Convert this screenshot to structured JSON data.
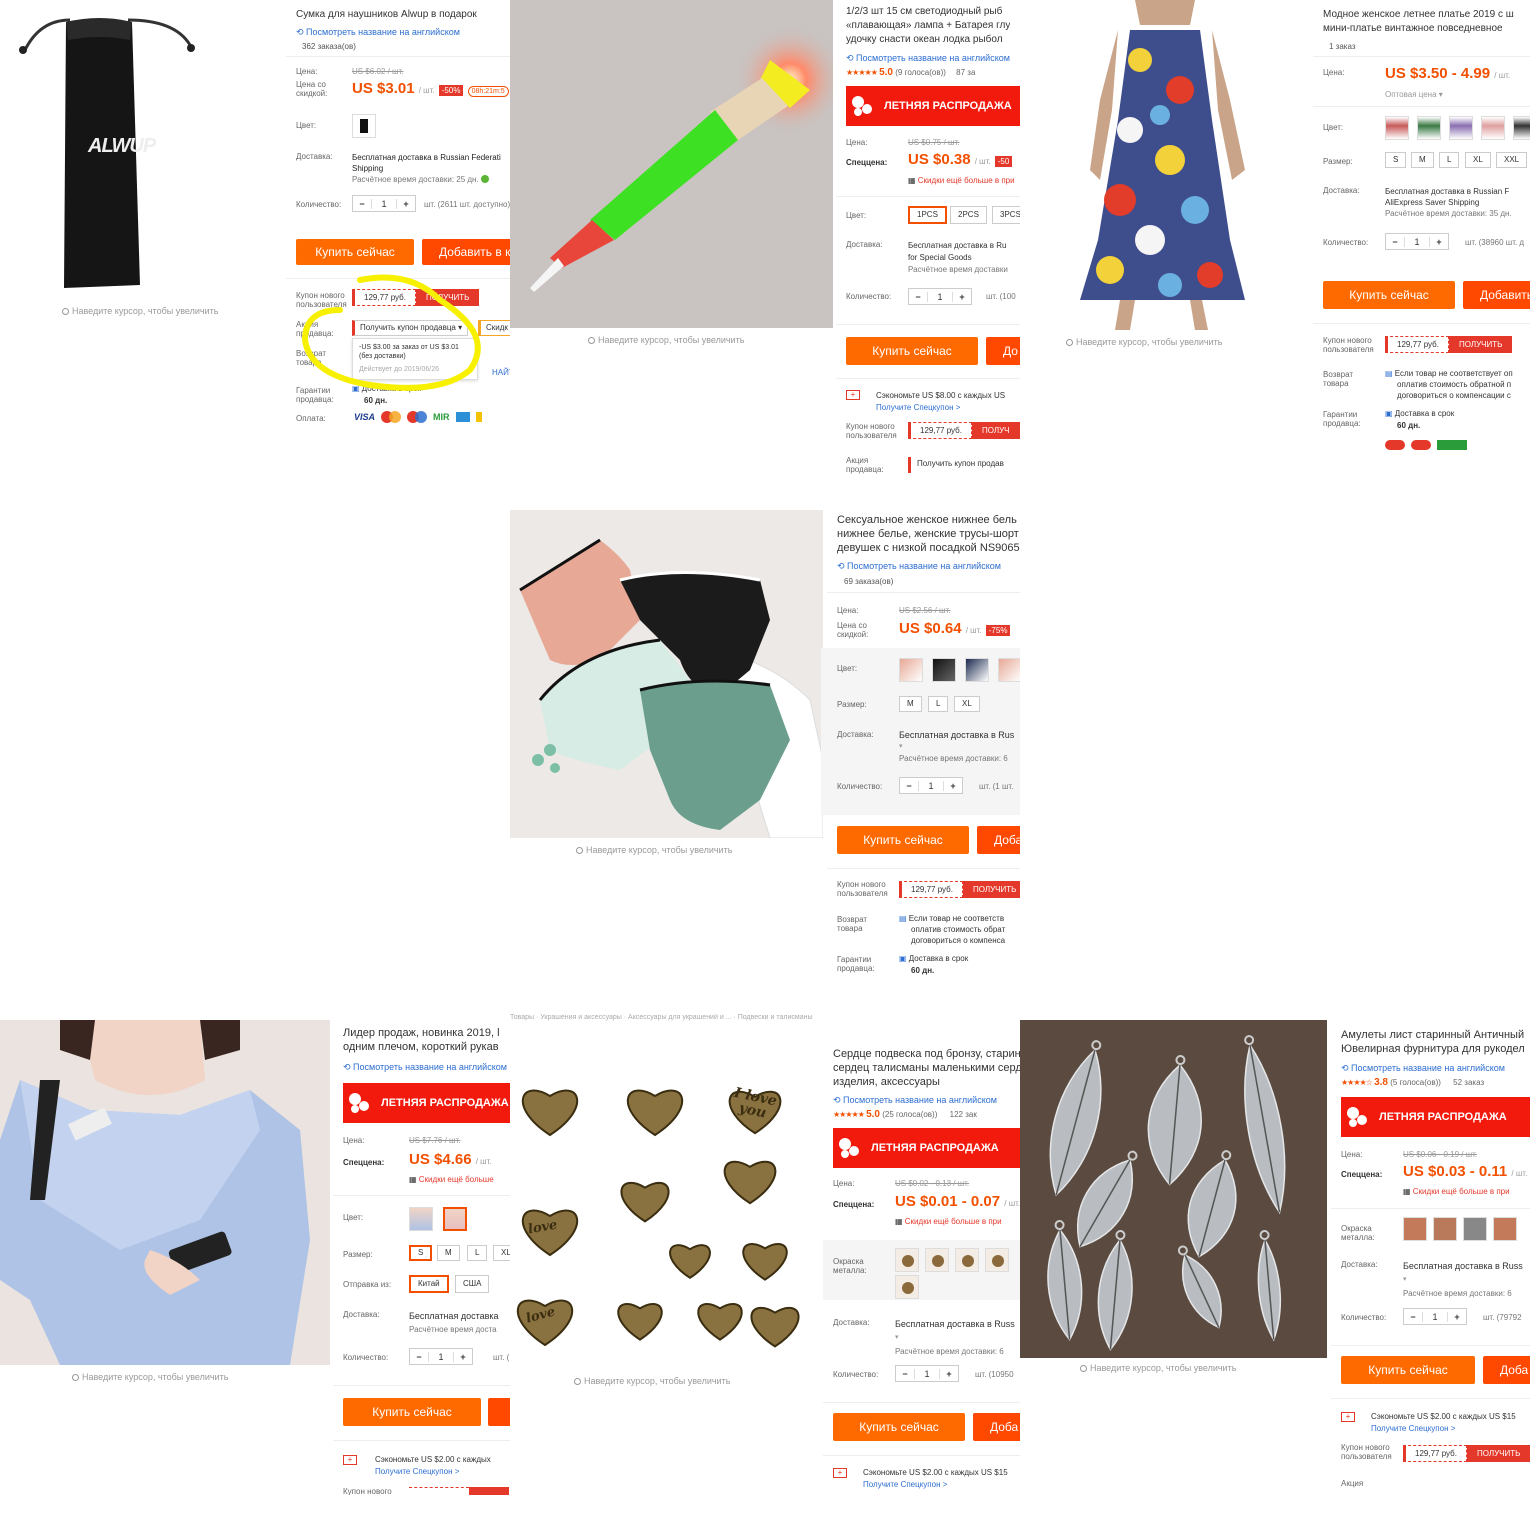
{
  "common": {
    "zoom_hint": "Наведите курсор, чтобы увеличить",
    "translate_link": "Посмотреть название на английском",
    "buy_now": "Купить сейчас",
    "add_to_cart": "Добавить в корзину",
    "add_short": "Доба",
    "add_short2": "Добавить",
    "new_user_coupon_label": "Купон нового пользователя",
    "coupon_amount": "129,77 руб.",
    "get_btn": "ПОЛУЧИТЬ",
    "summer_sale": "ЛЕТНЯЯ РАСПРОДАЖА",
    "price_label": "Цена:",
    "discount_price_label": "Цена со скидкой:",
    "special_label": "Спеццена:",
    "color_label": "Цвет:",
    "size_label": "Размер:",
    "delivery_label": "Доставка:",
    "quantity_label": "Количество:",
    "qty_value": "1",
    "minus": "−",
    "plus": "+",
    "est_delivery": "Расчётное время доставки:",
    "more_discounts": "Скидки ещё больше в при",
    "return_label": "Возврат товара",
    "guarantee_label": "Гарантии продавца:",
    "on_time": "Доставка в срок",
    "days60": "60 дн.",
    "metal_color_label": "Окраска металла:",
    "save_text": "Сэкономьте US $2.00 с каждых US $15",
    "get_special_coupon": "Получите Спецкупон >",
    "unit_suffix": "/ шт."
  },
  "p1": {
    "title": "Сумка для наушников Alwup в подарок",
    "orders": "362 заказа(ов)",
    "brand": "ALWUP",
    "old_price": "US $6.02 / шт.",
    "price": "US $3.01",
    "discount": "-50%",
    "timer": "08h:21m:5",
    "delivery": "Бесплатная доставка в Russian Federati",
    "delivery2": "Shipping",
    "est": "Расчётное время доставки: 25 дн.",
    "stock": "шт. (2611 шт. доступно)",
    "add": "Добавить в ко",
    "seller_promo_label": "Акция продавца:",
    "seller_coupon": "Получить купон продавца",
    "seller_coupon2": "Скидк",
    "coupon_detail1": "-US $3.00 за заказ от US $3.01",
    "coupon_detail2": "(без доставки)",
    "coupon_valid": "Действует до 2019/06/26",
    "find": "НАЙТ",
    "payment_label": "Оплата:",
    "payments": [
      "VISA",
      "MIR"
    ]
  },
  "p2": {
    "title1": "1/2/3 шт 15 см светодиодный рыб",
    "title2": "«плавающая» лампа + Батарея глу",
    "title3": "удочку снасти океан лодка рыбол",
    "rating": "5.0",
    "votes": "(9 голоса(ов))",
    "orders": "87 за",
    "old_price": "US $0.75 / шт.",
    "price": "US $0.38",
    "discount": "-50",
    "colors": [
      "1PCS",
      "2PCS",
      "3PCS"
    ],
    "delivery": "Бесплатная доставка в Ru",
    "delivery2": "for Special Goods",
    "est": "Расчётное время доставки",
    "stock": "шт. (100",
    "add": "До",
    "save_text": "Сэкономьте US $8.00 с каждых US",
    "get_short": "ПОЛУЧ",
    "seller_promo_label": "Акция продавца:",
    "seller_coupon": "Получить купон продав"
  },
  "p3": {
    "title1": "Модное женское летнее платье 2019 с ш",
    "title2": "мини-платье винтажное повседневное",
    "orders": "1 заказ",
    "price": "US $3.50 - 4.99",
    "wholesale": "Оптовая цена",
    "sizes": [
      "S",
      "M",
      "L",
      "XL",
      "XXL"
    ],
    "delivery": "Бесплатная доставка в Russian F",
    "delivery2": "AliExpress Saver Shipping",
    "est": "Расчётное время доставки: 35 дн.",
    "stock": "шт. (38960 шт. д",
    "return1": "Если товар не соответствует оп",
    "return2": "оплатив стоимость обратной п",
    "return3": "договориться о компенсации с"
  },
  "p4": {
    "title1": "Сексуальное женское нижнее бель",
    "title2": "нижнее белье, женские трусы-шорт",
    "title3": "девушек с низкой посадкой NS9065",
    "orders": "69 заказа(ов)",
    "old_price": "US $2.56 / шт.",
    "price": "US $0.64",
    "discount": "-75%",
    "sizes": [
      "M",
      "L",
      "XL"
    ],
    "delivery": "Бесплатная доставка в Rus",
    "est": "Расчётное время доставки: 6",
    "stock": "шт. (1 шт.",
    "return1": "Если товар не соответств",
    "return2": "оплатив стоимость обрат",
    "return3": "договориться о компенса"
  },
  "p5": {
    "title1": "Лидер продаж, новинка 2019, l",
    "title2": "одним плечом, короткий рукав",
    "old_price": "US $7.76 / шт.",
    "price": "US $4.66",
    "sizes": [
      "S",
      "M",
      "L",
      "XL"
    ],
    "ship_from_label": "Отправка из:",
    "ship_from": [
      "Китай",
      "США"
    ],
    "delivery": "Бесплатная доставка",
    "est": "Расчётное время доста",
    "stock": "шт. (",
    "save_text": "Сэкономьте US $2.00 с каждых",
    "more_discounts": "Скидки ещё больше",
    "breadcrumb": "Товары · Украшения и аксессуары · Аксессуары для украшений и ... · Подвески и талисманы",
    "truncated_label": "Купон нового"
  },
  "p6": {
    "title1": "Сердце подвеска под бронзу, старин",
    "title2": "сердец талисманы маленькими серд",
    "title3": "изделия, аксессуары",
    "rating": "5.0",
    "votes": "(25 голоса(ов))",
    "orders": "122 зак",
    "old_price": "US $0.02 - 0.13 / шт.",
    "price": "US $0.01 - 0.07",
    "delivery": "Бесплатная доставка в Russ",
    "est": "Расчётное время доставки: 6",
    "stock": "шт. (10950",
    "charm_texts": [
      "I love you",
      "love",
      "love"
    ]
  },
  "p7": {
    "title1": "Амулеты лист старинный Античный",
    "title2": "Ювелирная фурнитура для рукодел",
    "rating": "3.8",
    "votes": "(5 голоса(ов))",
    "orders": "52 заказ",
    "old_price": "US $0.06 - 0.19 / шт.",
    "price": "US $0.03 - 0.11",
    "delivery": "Бесплатная доставка в Russ",
    "est": "Расчётное время доставки: 6",
    "stock": "шт. (79792",
    "promo_short": "Акция"
  },
  "colors": {
    "accent": "#f25000",
    "sale_red": "#f21a0c",
    "buy_orange": "#ff6a00",
    "link_blue": "#2d6ed1",
    "highlight_yellow": "#f7f000"
  }
}
